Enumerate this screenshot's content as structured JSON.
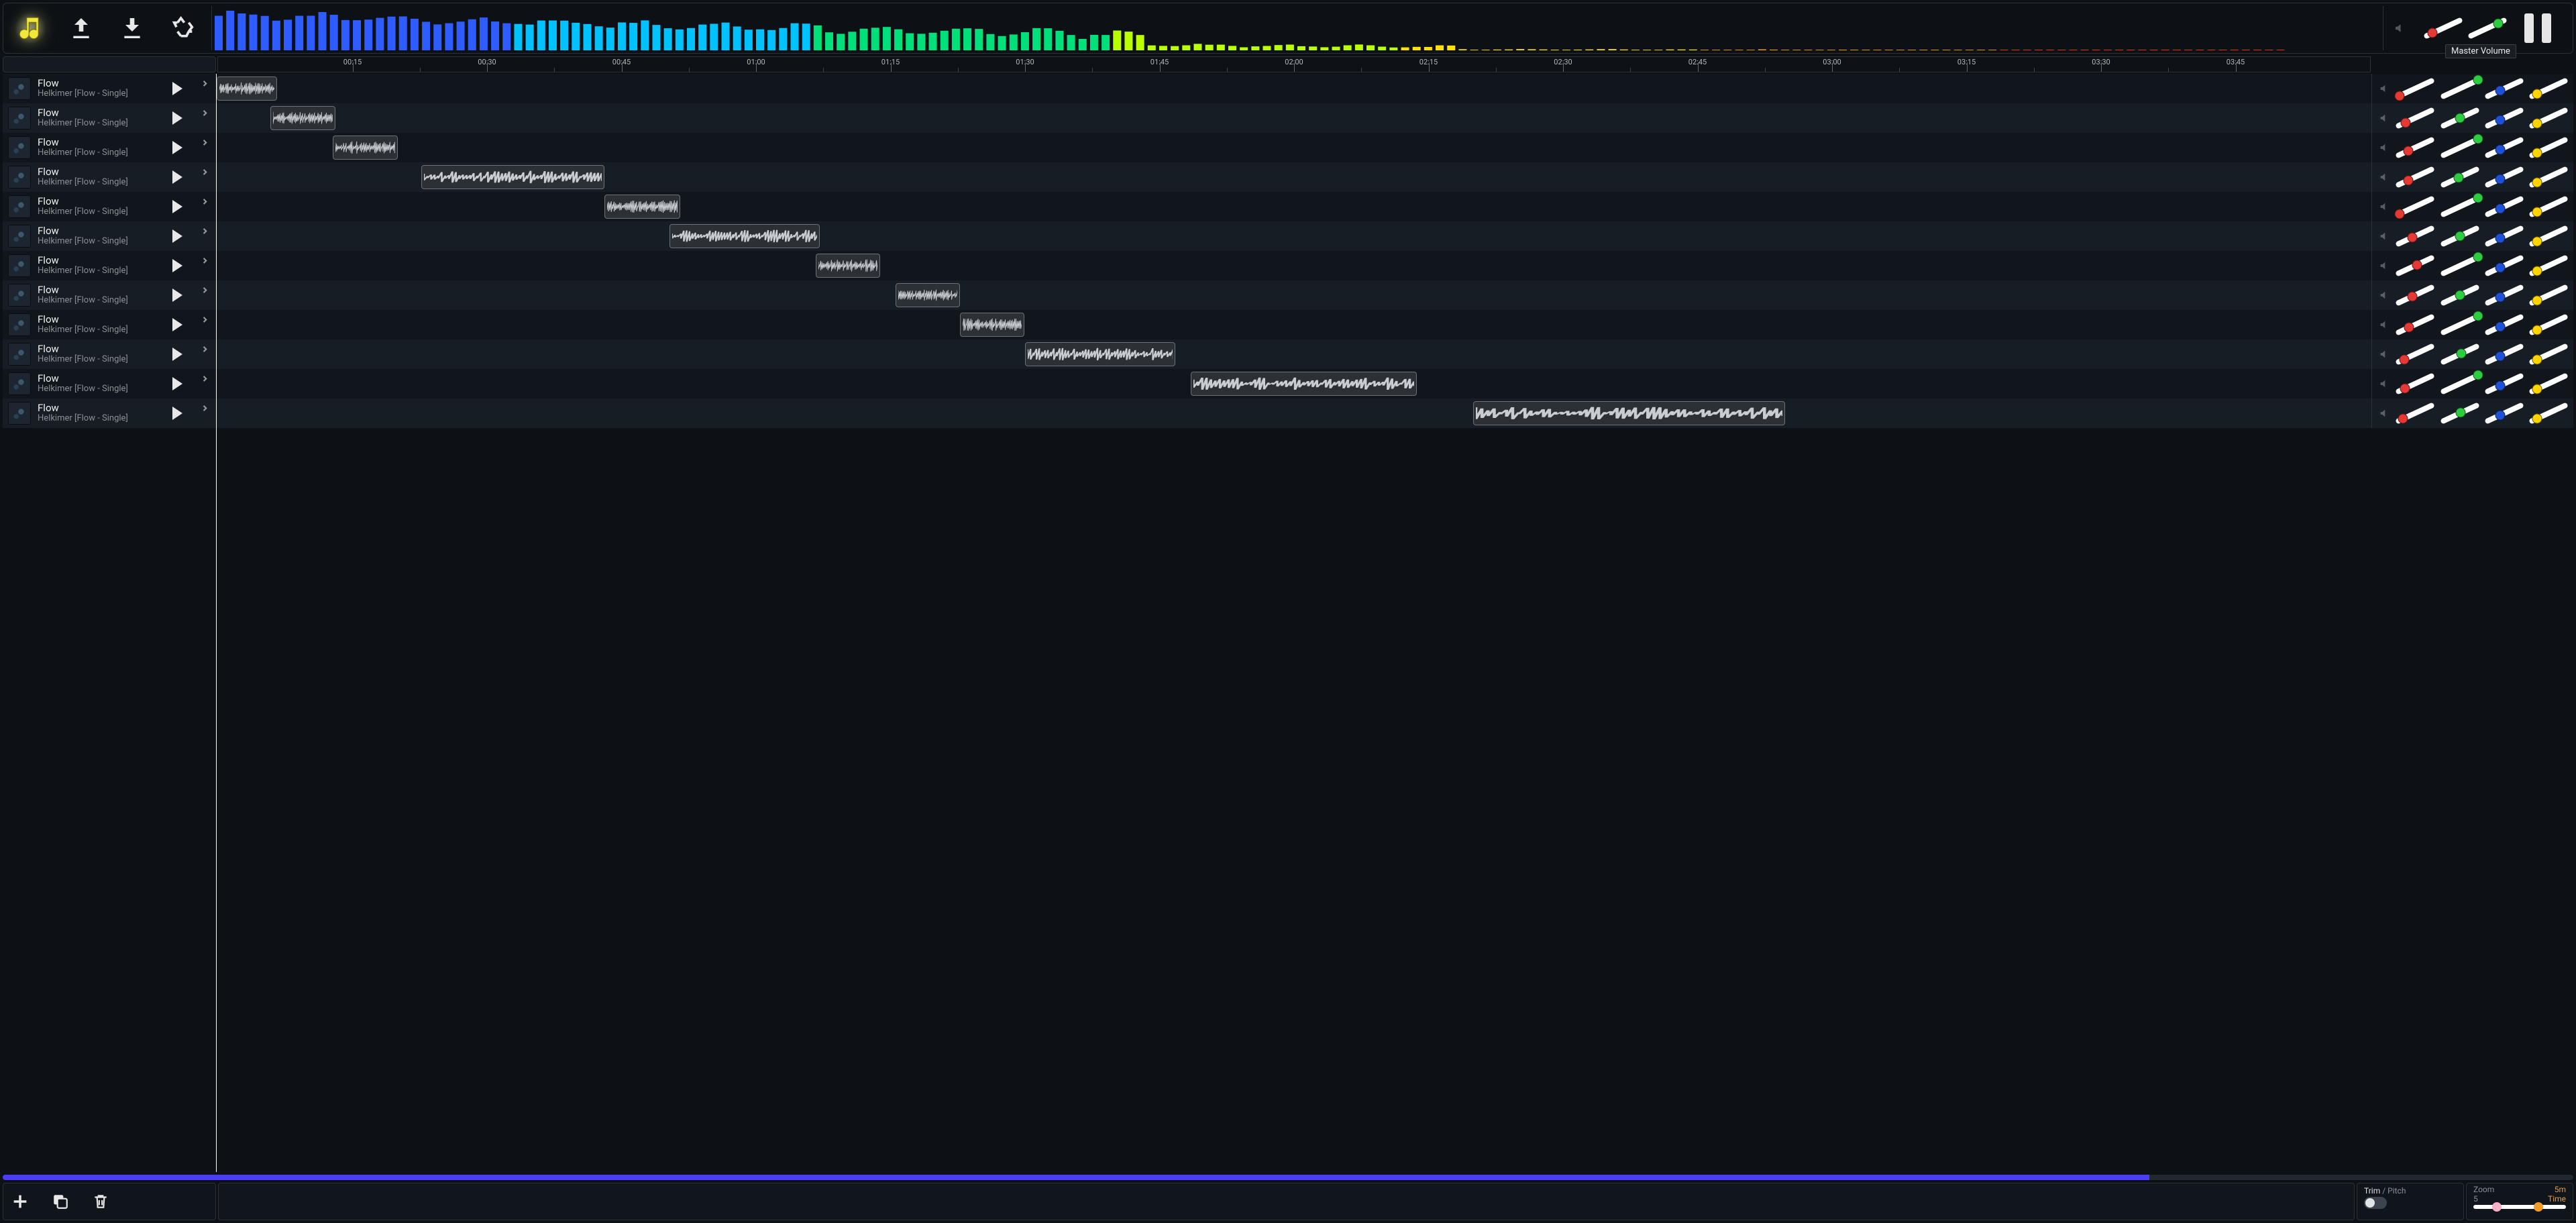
{
  "toolbar": {
    "music_library_label": "Music Library",
    "upload_label": "Upload",
    "download_label": "Download",
    "recycle_label": "Recycle",
    "pause_label": "Pause"
  },
  "master": {
    "tooltip": "Master Volume",
    "volume": 0.22,
    "balance": 0.78
  },
  "ruler": {
    "ticks": [
      "00:15",
      "00:30",
      "00:45",
      "01:00",
      "01:15",
      "01:30",
      "01:45",
      "02:00",
      "02:15",
      "02:30",
      "02:45",
      "03:00",
      "03:15",
      "03:30",
      "03:45"
    ]
  },
  "tracks": [
    {
      "title": "Flow",
      "subtitle": "Helkimer [Flow - Single]",
      "clip_start": 0.0,
      "clip_len": 0.028,
      "mix": {
        "vol": 0.08,
        "pan": 0.98,
        "fx": 0.4,
        "send": 0.2
      }
    },
    {
      "title": "Flow",
      "subtitle": "Helkimer [Flow - Single]",
      "clip_start": 0.025,
      "clip_len": 0.03,
      "mix": {
        "vol": 0.25,
        "pan": 0.5,
        "fx": 0.4,
        "send": 0.2
      }
    },
    {
      "title": "Flow",
      "subtitle": "Helkimer [Flow - Single]",
      "clip_start": 0.054,
      "clip_len": 0.03,
      "mix": {
        "vol": 0.32,
        "pan": 0.98,
        "fx": 0.4,
        "send": 0.2
      }
    },
    {
      "title": "Flow",
      "subtitle": "Helkimer [Flow - Single]",
      "clip_start": 0.095,
      "clip_len": 0.085,
      "mix": {
        "vol": 0.32,
        "pan": 0.48,
        "fx": 0.4,
        "send": 0.2
      }
    },
    {
      "title": "Flow",
      "subtitle": "Helkimer [Flow - Single]",
      "clip_start": 0.18,
      "clip_len": 0.035,
      "mix": {
        "vol": 0.08,
        "pan": 0.98,
        "fx": 0.4,
        "send": 0.2
      }
    },
    {
      "title": "Flow",
      "subtitle": "Helkimer [Flow - Single]",
      "clip_start": 0.21,
      "clip_len": 0.07,
      "mix": {
        "vol": 0.42,
        "pan": 0.5,
        "fx": 0.4,
        "send": 0.2
      }
    },
    {
      "title": "Flow",
      "subtitle": "Helkimer [Flow - Single]",
      "clip_start": 0.278,
      "clip_len": 0.03,
      "mix": {
        "vol": 0.55,
        "pan": 0.98,
        "fx": 0.4,
        "send": 0.2
      }
    },
    {
      "title": "Flow",
      "subtitle": "Helkimer [Flow - Single]",
      "clip_start": 0.315,
      "clip_len": 0.03,
      "mix": {
        "vol": 0.42,
        "pan": 0.5,
        "fx": 0.4,
        "send": 0.2
      }
    },
    {
      "title": "Flow",
      "subtitle": "Helkimer [Flow - Single]",
      "clip_start": 0.345,
      "clip_len": 0.03,
      "mix": {
        "vol": 0.34,
        "pan": 0.98,
        "fx": 0.4,
        "send": 0.2
      }
    },
    {
      "title": "Flow",
      "subtitle": "Helkimer [Flow - Single]",
      "clip_start": 0.375,
      "clip_len": 0.07,
      "mix": {
        "vol": 0.2,
        "pan": 0.55,
        "fx": 0.4,
        "send": 0.2
      }
    },
    {
      "title": "Flow",
      "subtitle": "Helkimer [Flow - Single]",
      "clip_start": 0.452,
      "clip_len": 0.105,
      "mix": {
        "vol": 0.22,
        "pan": 0.98,
        "fx": 0.4,
        "send": 0.2
      }
    },
    {
      "title": "Flow",
      "subtitle": "Helkimer [Flow - Single]",
      "clip_start": 0.583,
      "clip_len": 0.145,
      "mix": {
        "vol": 0.18,
        "pan": 0.52,
        "fx": 0.4,
        "send": 0.2
      }
    }
  ],
  "progress": 0.835,
  "bottom": {
    "add_label": "Add Track",
    "duplicate_label": "Duplicate",
    "delete_label": "Delete",
    "trim_toggle_label_on": "Trim",
    "trim_toggle_label_off": "Pitch",
    "trim_on": true,
    "zoom_label": "Zoom",
    "zoom_value": "5",
    "zoom_time_value": "5m",
    "zoom_time_label": "Time",
    "zoom_slider_a": 0.25,
    "zoom_slider_b": 0.7
  },
  "chart_data": {
    "type": "bar",
    "description": "Audio frequency spectrum visualization",
    "bars": 180,
    "color_gradient": [
      "#2e5cff",
      "#00c2ff",
      "#00e07a",
      "#baff00",
      "#ffe200",
      "#ff9a00",
      "#ff3a00"
    ]
  }
}
